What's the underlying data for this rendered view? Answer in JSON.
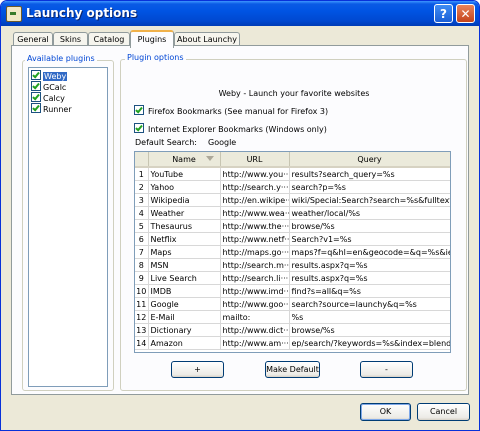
{
  "window": {
    "title": "Launchy options",
    "help_label": "?",
    "close_label": "✕"
  },
  "tabs": [
    {
      "label": "General"
    },
    {
      "label": "Skins"
    },
    {
      "label": "Catalog"
    },
    {
      "label": "Plugins"
    },
    {
      "label": "About Launchy"
    }
  ],
  "available_plugins": {
    "legend": "Available plugins",
    "items": [
      {
        "label": "Weby",
        "checked": true,
        "selected": true
      },
      {
        "label": "GCalc",
        "checked": true,
        "selected": false
      },
      {
        "label": "Calcy",
        "checked": true,
        "selected": false
      },
      {
        "label": "Runner",
        "checked": true,
        "selected": false
      }
    ]
  },
  "plugin_options": {
    "legend": "Plugin options",
    "headline": "Weby - Launch your favorite websites",
    "firefox_label": "Firefox Bookmarks (See manual for Firefox 3)",
    "ie_label": "Internet Explorer Bookmarks (Windows only)",
    "default_search_label": "Default Search:",
    "default_search_value": "Google",
    "table": {
      "columns": [
        "",
        "Name",
        "URL",
        "Query"
      ],
      "rows": [
        [
          "1",
          "YouTube",
          "http://www.you···",
          "results?search_query=%s"
        ],
        [
          "2",
          "Yahoo",
          "http://search.y···",
          "search?p=%s"
        ],
        [
          "3",
          "Wikipedia",
          "http://en.wikipe···",
          "wiki/Special:Search?search=%s&fulltext=···"
        ],
        [
          "4",
          "Weather",
          "http://www.wea···",
          "weather/local/%s"
        ],
        [
          "5",
          "Thesaurus",
          "http://www.the···",
          "browse/%s"
        ],
        [
          "6",
          "Netflix",
          "http://www.netf···",
          "Search?v1=%s"
        ],
        [
          "7",
          "Maps",
          "http://maps.go···",
          "maps?f=q&hl=en&geocode=&q=%s&ie=UT···"
        ],
        [
          "8",
          "MSN",
          "http://search.m···",
          "results.aspx?q=%s"
        ],
        [
          "9",
          "Live Search",
          "http://search.li···",
          "results.aspx?q=%s"
        ],
        [
          "10",
          "IMDB",
          "http://www.imd···",
          "find?s=all&q=%s"
        ],
        [
          "11",
          "Google",
          "http://www.goo···",
          "search?source=launchy&q=%s"
        ],
        [
          "12",
          "E-Mail",
          "mailto:",
          "%s"
        ],
        [
          "13",
          "Dictionary",
          "http://www.dict···",
          "browse/%s"
        ],
        [
          "14",
          "Amazon",
          "http://www.am···",
          "ep/search/?keywords=%s&index=blended"
        ]
      ]
    },
    "add_label": "+",
    "make_default_label": "Make Default",
    "remove_label": "-"
  },
  "footer": {
    "ok_label": "OK",
    "cancel_label": "Cancel"
  },
  "colors": {
    "titlebar": "#0054e3",
    "accent_tab": "#f0b14a",
    "legend_text": "#0046d5",
    "selection": "#316ac5"
  }
}
